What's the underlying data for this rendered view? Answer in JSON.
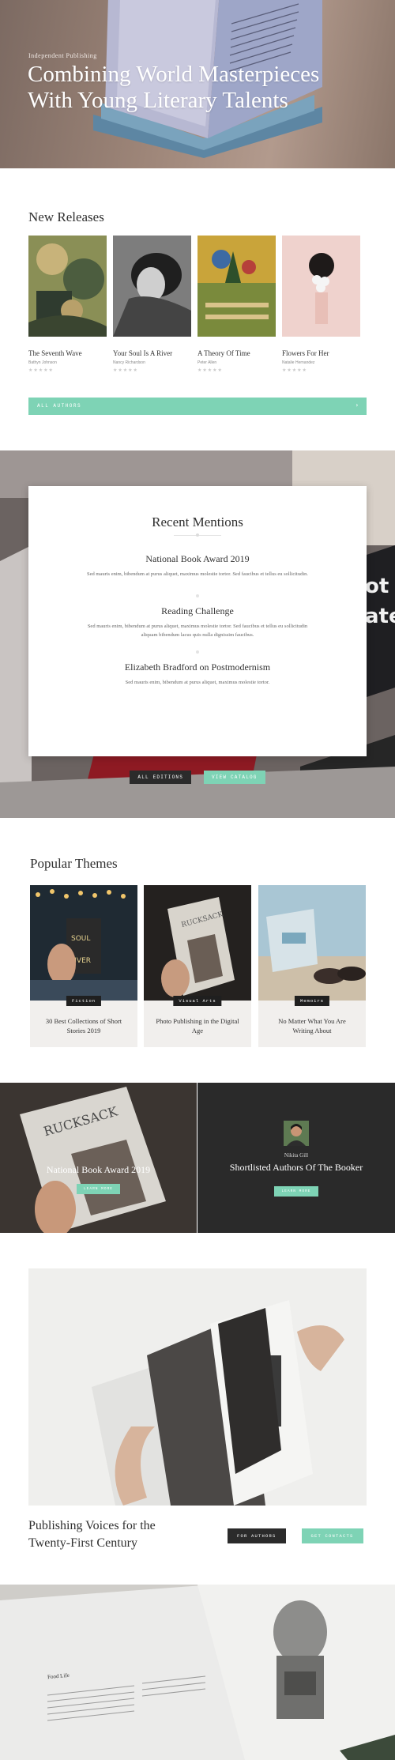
{
  "hero": {
    "kicker": "Independent Publishing",
    "title": "Combining World Masterpieces With Young Literary Talents"
  },
  "releases": {
    "title": "New Releases",
    "books": [
      {
        "title": "The Seventh Wave",
        "author": "Bathyn Johnson",
        "rating": "★★★★★"
      },
      {
        "title": "Your Soul Is A River",
        "author": "Nancy Richardson",
        "rating": "★★★★★"
      },
      {
        "title": "A Theory Of Time",
        "author": "Peter Allen",
        "rating": "★★★★★"
      },
      {
        "title": "Flowers For Her",
        "author": "Natalie Hernandez",
        "rating": "★★★★★"
      }
    ],
    "all_authors": "ALL AUTHORS",
    "arrow": "›"
  },
  "mentions": {
    "title": "Recent Mentions",
    "items": [
      {
        "title": "National Book Award 2019",
        "text": "Sed mauris enim, bibendum at purus aliquet, maximus molestie tortor. Sed faucibus et tellus eu sollicitudin."
      },
      {
        "title": "Reading Challenge",
        "text": "Sed mauris enim, bibendum at purus aliquet, maximus molestie tortor. Sed faucibus et tellus eu sollicitudin aliquam bibendum lacus quis nulla dignissim faucibus."
      },
      {
        "title": "Elizabeth Bradford on Postmodernism",
        "text": "Sed mauris enim, bibendum at purus aliquet, maximus molestie tortor."
      }
    ],
    "btn_editions": "ALL EDITIONS",
    "btn_catalog": "VIEW CATALOG"
  },
  "themes": {
    "title": "Popular Themes",
    "cards": [
      {
        "tag": "Fiction",
        "title": "30 Best Collections of Short Stories 2019"
      },
      {
        "tag": "Visual Arts",
        "title": "Photo Publishing in the Digital Age"
      },
      {
        "tag": "Memoirs",
        "title": "No Matter What You Are Writing About"
      }
    ]
  },
  "split": {
    "award": "National Book Award 2019",
    "award_btn": "LEARN MORE",
    "author": "Nikita Gill",
    "shortlist": "Shortlisted Authors Of The Booker",
    "shortlist_btn": "LEARN MORE"
  },
  "voices": {
    "title": "Publishing Voices for the Twenty-First Century",
    "btn_authors": "FOR AUTHORS",
    "btn_contacts": "GET CONTACTS"
  },
  "bottom": {
    "page_heading": "Food Life"
  }
}
